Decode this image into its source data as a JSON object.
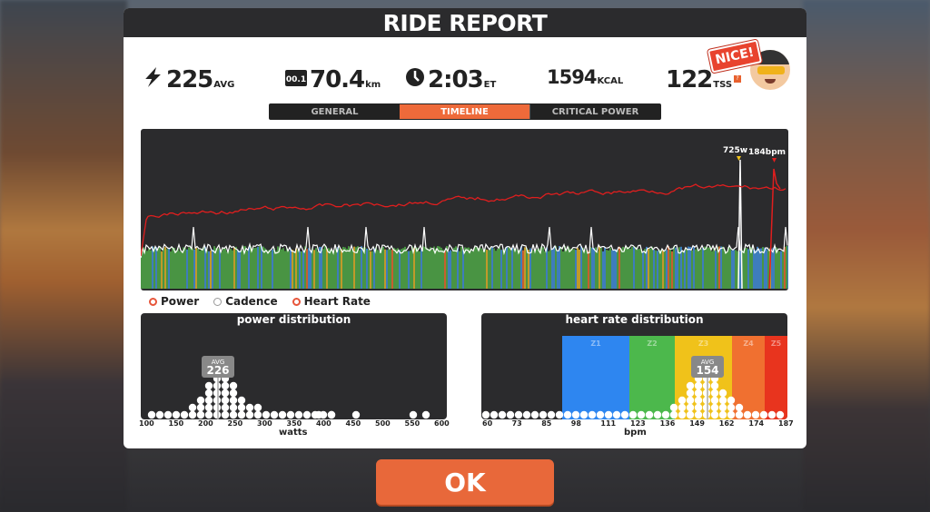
{
  "modal": {
    "title": "RIDE REPORT"
  },
  "stats": {
    "power": {
      "value": "225",
      "unit": "AVG",
      "icon": "lightning-icon"
    },
    "distance": {
      "value": "70.4",
      "unit": "km",
      "icon": "odometer-icon",
      "icon_text": "00.1"
    },
    "time": {
      "value": "2:03",
      "unit": "ET",
      "icon": "clock-icon"
    },
    "calories": {
      "value": "1594",
      "unit": "KCAL"
    },
    "tss": {
      "value": "122",
      "unit": "TSS"
    },
    "badge": "NICE!"
  },
  "tabs": [
    "GENERAL",
    "TIMELINE",
    "CRITICAL POWER"
  ],
  "active_tab": "TIMELINE",
  "timeline": {
    "power_peak_label": "725w",
    "hr_peak_label": "184bpm"
  },
  "legend": {
    "power": "Power",
    "cadence": "Cadence",
    "heart_rate": "Heart Rate"
  },
  "power_distribution": {
    "title": "power distribution",
    "avg_label": "AVG",
    "avg_value": "226",
    "axis_ticks": [
      "100",
      "150",
      "200",
      "250",
      "300",
      "350",
      "400",
      "450",
      "500",
      "550",
      "600"
    ],
    "axis_title": "watts"
  },
  "hr_distribution": {
    "title": "heart rate distribution",
    "avg_label": "AVG",
    "avg_value": "154",
    "zones": [
      "Z1",
      "Z2",
      "Z3",
      "Z4",
      "Z5"
    ],
    "zone_colors": [
      "#2e86f0",
      "#4cb84c",
      "#f0c21a",
      "#f07030",
      "#e8341e"
    ],
    "axis_ticks": [
      "60",
      "73",
      "85",
      "98",
      "111",
      "123",
      "136",
      "149",
      "162",
      "174",
      "187"
    ],
    "axis_title": "bpm"
  },
  "ok_button": "OK",
  "colors": {
    "accent": "#e8683a",
    "hr_line": "#e01e1e",
    "power_line": "#ffffff"
  }
}
